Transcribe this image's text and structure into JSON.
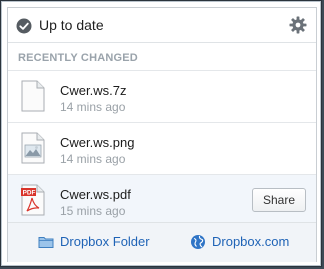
{
  "header": {
    "status_text": "Up to date",
    "status_icon": "check-circle-icon",
    "settings_icon": "gear-icon"
  },
  "section": {
    "title": "RECENTLY CHANGED"
  },
  "files": [
    {
      "name": "Cwer.ws.7z",
      "time": "14 mins ago",
      "icon": "generic-file-icon"
    },
    {
      "name": "Cwer.ws.png",
      "time": "14 mins ago",
      "icon": "image-file-icon"
    },
    {
      "name": "Cwer.ws.pdf",
      "time": "15 mins ago",
      "icon": "pdf-file-icon",
      "action": "Share"
    }
  ],
  "footer": {
    "folder_link": "Dropbox Folder",
    "site_link": "Dropbox.com"
  },
  "colors": {
    "link": "#1f63b6",
    "muted": "#9aa1a7",
    "pdf_red": "#d9342b"
  }
}
